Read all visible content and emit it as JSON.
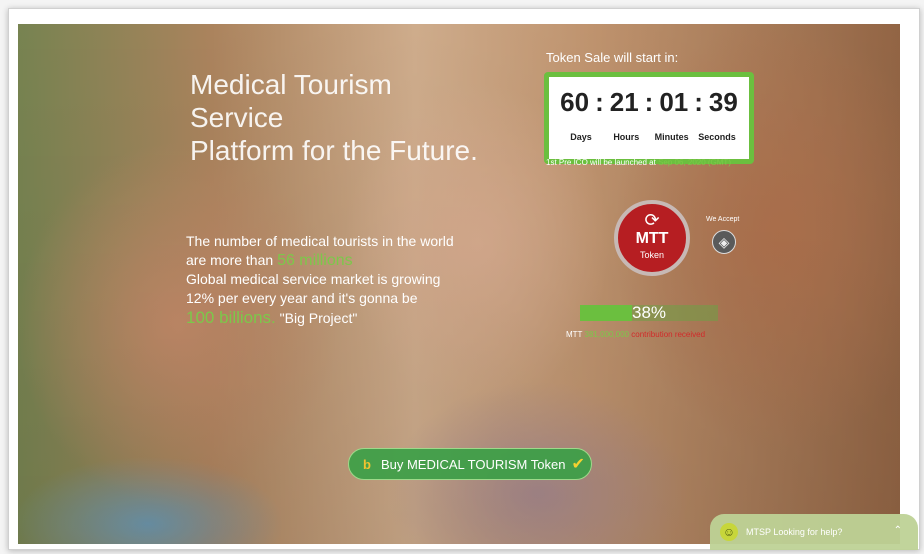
{
  "hero": {
    "headline_line1": "Medical Tourism Service",
    "headline_line2": "Platform for the Future.",
    "pitch": {
      "l1": "The number of medical tourists in the world",
      "l2_pre": "are more than ",
      "l2_hl": "56 millions",
      "l3": "Global medical service market is growing",
      "l4": "12% per every year and it's gonna be",
      "l5_hl": "100 billions.",
      "l5_post": " \"Big Project\""
    }
  },
  "countdown": {
    "title": "Token Sale will start in:",
    "days": "60",
    "hours": "21",
    "minutes": "01",
    "seconds": "39",
    "sep": ":",
    "label_days": "Days",
    "label_hours": "Hours",
    "label_minutes": "Minutes",
    "label_seconds": "Seconds",
    "preico_text": "1st Pre ICO will be launched at ",
    "preico_date": "Sep 06, 2020 (GMT)"
  },
  "token": {
    "symbol": "MTT",
    "subtitle": "Token",
    "accept_label": "We Accept"
  },
  "progress": {
    "percent_label": "38%",
    "percent_value": 38,
    "raised_prefix": "MTT ",
    "raised_amount": "381,000,000",
    "raised_suffix": " contribution received"
  },
  "buy": {
    "icon_letter": "b",
    "label": "Buy MEDICAL TOURISM Token",
    "check": "✔"
  },
  "chat": {
    "avatar": "☺",
    "label": "MTSP Looking for help?",
    "chevron": "⌃"
  },
  "nav": {
    "active_index": 8,
    "count": 12
  }
}
